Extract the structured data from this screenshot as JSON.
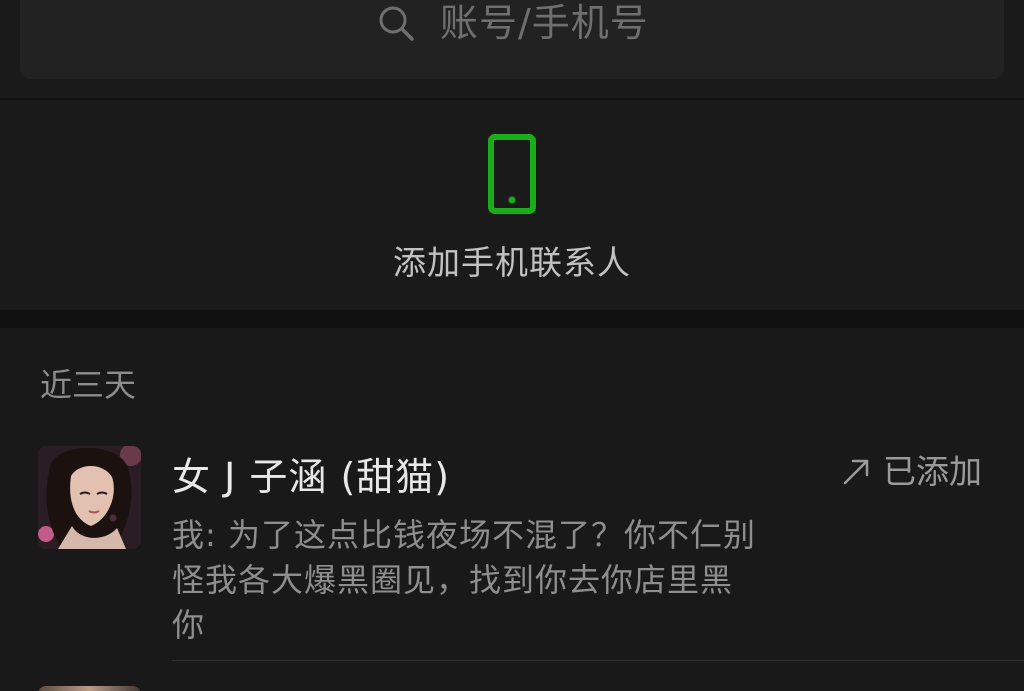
{
  "search": {
    "placeholder": "账号/手机号",
    "icon": "search-icon"
  },
  "add_phone_contacts": {
    "label": "添加手机联系人",
    "icon": "mobile-phone-icon",
    "icon_color": "#1aad19"
  },
  "recent": {
    "header": "近三天",
    "items": [
      {
        "name": "女 J 子涵 (甜猫)",
        "message": "我: 为了这点比钱夜场不混了？你不仁别怪我各大爆黑圈见，找到你去你店里黑你",
        "status": "已添加",
        "status_icon": "arrow-up-right-icon",
        "avatar": "avatar"
      }
    ]
  },
  "colors": {
    "background": "#111111",
    "section_background": "#1a1a1a",
    "accent_green": "#1aad19",
    "text_primary": "#e8e8e8",
    "text_secondary": "#8e8e8e"
  }
}
